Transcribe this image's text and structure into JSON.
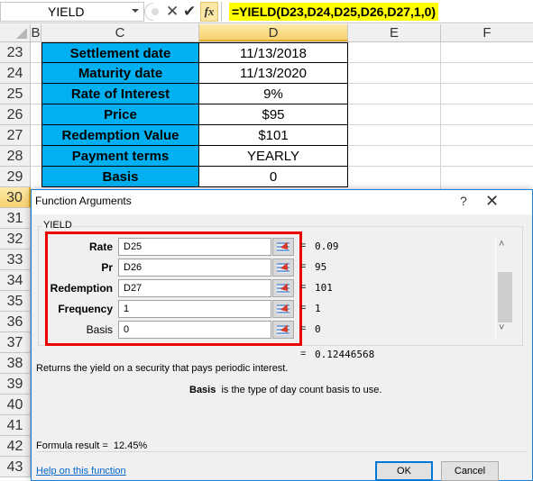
{
  "formula_bar": {
    "name_box": "YIELD",
    "cancel_icon": "✕",
    "enter_icon": "✔",
    "fx_label": "fx",
    "formula": "=YIELD(D23,D24,D25,D26,D27,1,0)"
  },
  "columns": [
    "B",
    "C",
    "D",
    "E",
    "F"
  ],
  "rows": [
    "23",
    "24",
    "25",
    "26",
    "27",
    "28",
    "29",
    "30",
    "31",
    "32",
    "33",
    "34",
    "35",
    "36",
    "37",
    "38",
    "39",
    "40",
    "41",
    "42",
    "43"
  ],
  "table": [
    {
      "label": "Settlement date",
      "value": "11/13/2018"
    },
    {
      "label": "Maturity date",
      "value": "11/13/2020"
    },
    {
      "label": "Rate of Interest",
      "value": "9%"
    },
    {
      "label": "Price",
      "value": "$95"
    },
    {
      "label": "Redemption Value",
      "value": "$101"
    },
    {
      "label": "Payment terms",
      "value": "YEARLY"
    },
    {
      "label": "Basis",
      "value": "0"
    }
  ],
  "dialog": {
    "title": "Function Arguments",
    "help_icon": "?",
    "close_icon": "✕",
    "function_name": "YIELD",
    "args": [
      {
        "label": "Rate",
        "input": "D25",
        "value": "0.09",
        "bold": true
      },
      {
        "label": "Pr",
        "input": "D26",
        "value": "95",
        "bold": true
      },
      {
        "label": "Redemption",
        "input": "D27",
        "value": "101",
        "bold": true
      },
      {
        "label": "Frequency",
        "input": "1",
        "value": "1",
        "bold": true
      },
      {
        "label": "Basis",
        "input": "0",
        "value": "0",
        "bold": false
      }
    ],
    "eq": "=",
    "overall_value": "0.12446568",
    "description": "Returns the yield on a security that pays periodic interest.",
    "arg_desc_name": "Basis",
    "arg_desc_text": "is the type of day count basis to use.",
    "formula_result_label": "Formula result =",
    "formula_result_value": "12.45%",
    "help_link": "Help on this function",
    "ok_label": "OK",
    "cancel_label": "Cancel",
    "scroll_up_icon": "˄",
    "scroll_down_icon": "˅"
  },
  "colors": {
    "label_fill": "#00b0f0",
    "formula_highlight": "#ffff00",
    "highlight_box": "#ee0000",
    "dialog_border": "#1c7fd6"
  }
}
